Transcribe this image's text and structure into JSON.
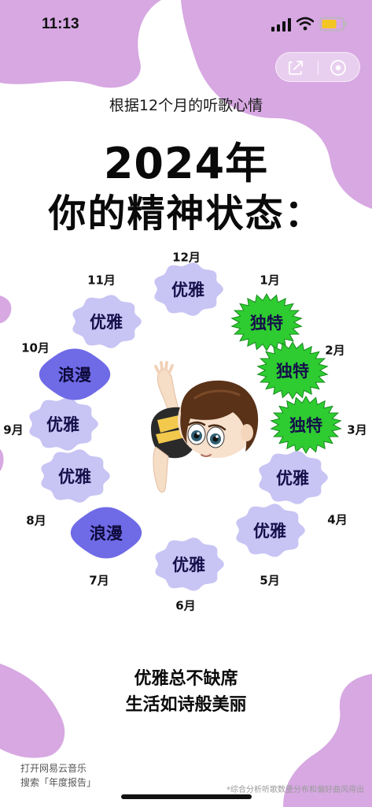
{
  "status_bar": {
    "time": "11:13"
  },
  "header": {
    "subtitle": "根据12个月的听歌心情",
    "year_title": "2024年",
    "state_title": "你的精神状态："
  },
  "moods": [
    {
      "month": "12月",
      "mood": "优雅",
      "style": "elegant"
    },
    {
      "month": "1月",
      "mood": "独特",
      "style": "unique"
    },
    {
      "month": "2月",
      "mood": "独特",
      "style": "unique"
    },
    {
      "month": "3月",
      "mood": "独特",
      "style": "unique"
    },
    {
      "month": "4月",
      "mood": "优雅",
      "style": "elegant"
    },
    {
      "month": "4月",
      "mood": "优雅",
      "style": "elegant"
    },
    {
      "month": "5月",
      "mood": "优雅",
      "style": "elegant"
    },
    {
      "month": "6月",
      "mood": "优雅",
      "style": "elegant"
    },
    {
      "month": "7月",
      "mood": "浪漫",
      "style": "romantic"
    },
    {
      "month": "8月",
      "mood": "优雅",
      "style": "elegant"
    },
    {
      "month": "9月",
      "mood": "优雅",
      "style": "elegant"
    },
    {
      "month": "10月",
      "mood": "浪漫",
      "style": "romantic"
    },
    {
      "month": "11月",
      "mood": "优雅",
      "style": "elegant"
    }
  ],
  "summary": {
    "line1": "优雅总不缺席",
    "line2": "生活如诗般美丽"
  },
  "footer": {
    "line1": "打开网易云音乐",
    "line2": "搜索「年度报告」",
    "footnote": "*综合分析听歌数量分布和偏好曲风得出"
  },
  "colors": {
    "background_blob": "#d7a8e2",
    "elegant_fill": "#c8c4f4",
    "romantic_fill": "#6f6ae6",
    "unique_fill": "#2ecc31",
    "unique_edge": "#178a1c"
  },
  "icons": [
    "signal-icon",
    "wifi-icon",
    "battery-icon",
    "share-icon",
    "target-icon"
  ]
}
